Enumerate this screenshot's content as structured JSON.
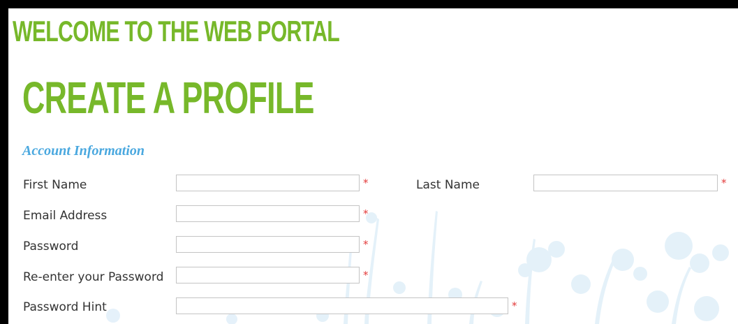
{
  "header": {
    "portal_title": "WELCOME TO THE WEB PORTAL",
    "page_title": "CREATE A PROFILE"
  },
  "account_section": {
    "heading": "Account Information",
    "required_marker": "*",
    "fields": {
      "first_name": {
        "label": "First Name",
        "value": "",
        "placeholder": ""
      },
      "last_name": {
        "label": "Last Name",
        "value": "",
        "placeholder": ""
      },
      "email": {
        "label": "Email Address",
        "value": "",
        "placeholder": ""
      },
      "password": {
        "label": "Password",
        "value": "",
        "placeholder": ""
      },
      "password_confirm": {
        "label": "Re-enter your Password",
        "value": "",
        "placeholder": ""
      },
      "password_hint": {
        "label": "Password Hint",
        "value": "",
        "placeholder": ""
      }
    }
  },
  "colors": {
    "title_green": "#77b82a",
    "section_blue": "#4aa8df",
    "required_red": "#e33b3b",
    "label_gray": "#333333",
    "background_art_blue": "#cfe6f5",
    "frame": "#000000"
  }
}
